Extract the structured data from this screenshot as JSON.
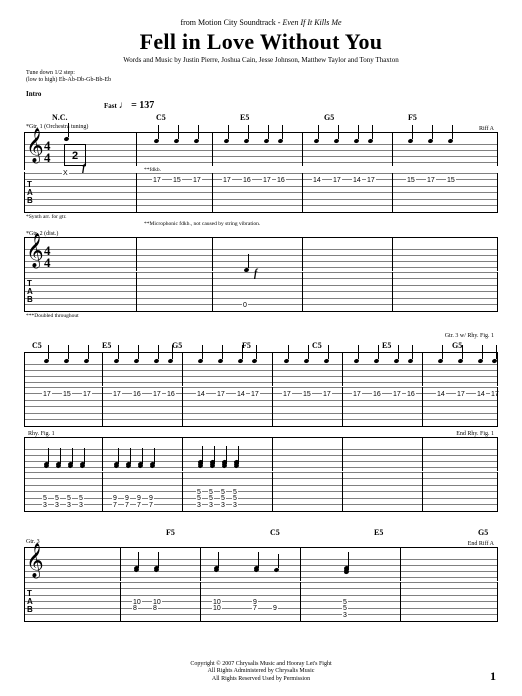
{
  "header": {
    "source_prefix": "from Motion City Soundtrack - ",
    "album": "Even If It Kills Me",
    "title": "Fell in Love Without You",
    "credits": "Words and Music by Justin Pierre, Joshua Cain, Jesse Johnson, Matthew Taylor and Tony Thaxton"
  },
  "tuning": {
    "line1": "Tune down 1/2 step:",
    "line2": "(low to high) Eb-Ab-Db-Gb-Bb-Eb"
  },
  "section": "Intro",
  "tempo": {
    "label": "Fast",
    "marking": "♩ = 137"
  },
  "chords": {
    "row1": [
      "N.C.",
      "C5",
      "E5",
      "G5",
      "F5"
    ],
    "row2": [
      "C5",
      "E5",
      "G5",
      "F5",
      "C5",
      "E5",
      "G5"
    ],
    "row3": [
      "F5",
      "C5",
      "E5",
      "G5"
    ]
  },
  "parts": {
    "gtr1": "*Gtr. 1 (Orchestra tuning)",
    "gtr2": "*Gtr. 2 (dist.)",
    "gtr3": "Gtr. 3"
  },
  "performance_notes": {
    "riff_a": "Riff A",
    "end_riff_a": "End Riff A",
    "rhy_fig1": "Rhy. Fig. 1",
    "end_rhy_fig1": "End Rhy. Fig. 1",
    "gtr3_riff": "Gtr. 3 w/ Rhy. Fig. 1",
    "fdkb": "**fdkb.",
    "fdkb_note": "**Microphonic fdkb., not caused by string vibration.",
    "doubled": "***Doubled throughout",
    "synth_note": "*Synth arr. for gtr.",
    "two_bars": "2",
    "dynamic": "f"
  },
  "tab_data": {
    "system1_gtr1": [
      {
        "s": 0,
        "p": 38,
        "f": "X"
      },
      {
        "s": 1,
        "p": 128,
        "f": "17"
      },
      {
        "s": 1,
        "p": 148,
        "f": "15"
      },
      {
        "s": 1,
        "p": 168,
        "f": "17"
      },
      {
        "s": 1,
        "p": 198,
        "f": "17"
      },
      {
        "s": 1,
        "p": 218,
        "f": "16"
      },
      {
        "s": 1,
        "p": 238,
        "f": "17"
      },
      {
        "s": 1,
        "p": 252,
        "f": "16"
      },
      {
        "s": 1,
        "p": 288,
        "f": "14"
      },
      {
        "s": 1,
        "p": 308,
        "f": "17"
      },
      {
        "s": 1,
        "p": 328,
        "f": "14"
      },
      {
        "s": 1,
        "p": 342,
        "f": "17"
      },
      {
        "s": 1,
        "p": 382,
        "f": "15"
      },
      {
        "s": 1,
        "p": 402,
        "f": "17"
      },
      {
        "s": 1,
        "p": 422,
        "f": "15"
      }
    ],
    "system1_gtr2": [
      {
        "s": 5,
        "p": 218,
        "f": "0"
      }
    ],
    "system2_gtr1": [
      {
        "s": 1,
        "p": 18,
        "f": "17"
      },
      {
        "s": 1,
        "p": 38,
        "f": "15"
      },
      {
        "s": 1,
        "p": 58,
        "f": "17"
      },
      {
        "s": 1,
        "p": 88,
        "f": "17"
      },
      {
        "s": 1,
        "p": 108,
        "f": "16"
      },
      {
        "s": 1,
        "p": 128,
        "f": "17"
      },
      {
        "s": 1,
        "p": 142,
        "f": "16"
      },
      {
        "s": 1,
        "p": 172,
        "f": "14"
      },
      {
        "s": 1,
        "p": 192,
        "f": "17"
      },
      {
        "s": 1,
        "p": 212,
        "f": "14"
      },
      {
        "s": 1,
        "p": 226,
        "f": "17"
      },
      {
        "s": 1,
        "p": 258,
        "f": "17"
      },
      {
        "s": 1,
        "p": 278,
        "f": "15"
      },
      {
        "s": 1,
        "p": 298,
        "f": "17"
      },
      {
        "s": 1,
        "p": 328,
        "f": "17"
      },
      {
        "s": 1,
        "p": 348,
        "f": "16"
      },
      {
        "s": 1,
        "p": 368,
        "f": "17"
      },
      {
        "s": 1,
        "p": 382,
        "f": "16"
      },
      {
        "s": 1,
        "p": 412,
        "f": "14"
      },
      {
        "s": 1,
        "p": 432,
        "f": "17"
      },
      {
        "s": 1,
        "p": 452,
        "f": "14"
      },
      {
        "s": 1,
        "p": 466,
        "f": "17"
      }
    ],
    "system2_gtr2": [
      {
        "s": 4,
        "p": 18,
        "f": "5"
      },
      {
        "s": 5,
        "p": 18,
        "f": "3"
      },
      {
        "s": 4,
        "p": 30,
        "f": "5"
      },
      {
        "s": 5,
        "p": 30,
        "f": "3"
      },
      {
        "s": 4,
        "p": 42,
        "f": "5"
      },
      {
        "s": 5,
        "p": 42,
        "f": "3"
      },
      {
        "s": 4,
        "p": 54,
        "f": "5"
      },
      {
        "s": 5,
        "p": 54,
        "f": "3"
      },
      {
        "s": 4,
        "p": 88,
        "f": "9"
      },
      {
        "s": 5,
        "p": 88,
        "f": "7"
      },
      {
        "s": 4,
        "p": 100,
        "f": "9"
      },
      {
        "s": 5,
        "p": 100,
        "f": "7"
      },
      {
        "s": 4,
        "p": 112,
        "f": "9"
      },
      {
        "s": 5,
        "p": 112,
        "f": "7"
      },
      {
        "s": 4,
        "p": 124,
        "f": "9"
      },
      {
        "s": 5,
        "p": 124,
        "f": "7"
      },
      {
        "s": 3,
        "p": 172,
        "f": "5"
      },
      {
        "s": 4,
        "p": 172,
        "f": "5"
      },
      {
        "s": 5,
        "p": 172,
        "f": "3"
      },
      {
        "s": 3,
        "p": 184,
        "f": "5"
      },
      {
        "s": 4,
        "p": 184,
        "f": "5"
      },
      {
        "s": 5,
        "p": 184,
        "f": "3"
      },
      {
        "s": 3,
        "p": 196,
        "f": "5"
      },
      {
        "s": 4,
        "p": 196,
        "f": "5"
      },
      {
        "s": 5,
        "p": 196,
        "f": "3"
      },
      {
        "s": 3,
        "p": 208,
        "f": "5"
      },
      {
        "s": 4,
        "p": 208,
        "f": "5"
      },
      {
        "s": 5,
        "p": 208,
        "f": "3"
      }
    ],
    "system3_gtr3": [
      {
        "s": 3,
        "p": 108,
        "f": "10"
      },
      {
        "s": 4,
        "p": 108,
        "f": "8"
      },
      {
        "s": 3,
        "p": 128,
        "f": "10"
      },
      {
        "s": 4,
        "p": 128,
        "f": "8"
      },
      {
        "s": 3,
        "p": 188,
        "f": "10"
      },
      {
        "s": 4,
        "p": 188,
        "f": "10"
      },
      {
        "s": 3,
        "p": 228,
        "f": "9"
      },
      {
        "s": 4,
        "p": 228,
        "f": "7"
      },
      {
        "s": 4,
        "p": 248,
        "f": "9"
      },
      {
        "s": 3,
        "p": 318,
        "f": "5"
      },
      {
        "s": 4,
        "p": 318,
        "f": "5"
      },
      {
        "s": 5,
        "p": 318,
        "f": "3"
      }
    ]
  },
  "footer": {
    "copyright": "Copyright © 2007 Chrysalis Music and Hooray Let's Fight",
    "rights1": "All Rights Administered by Chrysalis Music",
    "rights2": "All Rights Reserved   Used by Permission"
  },
  "page_number": "1"
}
